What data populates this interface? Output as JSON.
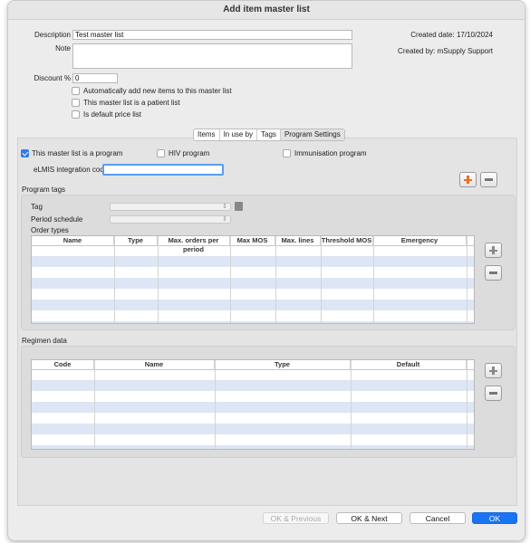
{
  "window": {
    "title": "Add item master list"
  },
  "header": {
    "description_label": "Description",
    "description_value": "Test master list",
    "note_label": "Note",
    "note_value": "",
    "discount_label": "Discount %",
    "discount_value": "0",
    "created_date": "Created date: 17/10/2024",
    "created_by": "Created by: mSupply Support",
    "checkboxes": [
      {
        "label": "Automatically add new items to this master list",
        "checked": false
      },
      {
        "label": "This master list is a patient list",
        "checked": false
      },
      {
        "label": "Is default price list",
        "checked": false
      }
    ]
  },
  "tabs": [
    {
      "label": "Items",
      "active": false
    },
    {
      "label": "In use by",
      "active": false
    },
    {
      "label": "Tags",
      "active": false
    },
    {
      "label": "Program Settings",
      "active": true
    }
  ],
  "program": {
    "is_program_label": "This master list is a program",
    "is_program_checked": true,
    "hiv_label": "HIV program",
    "hiv_checked": false,
    "immunisation_label": "Immunisation program",
    "immunisation_checked": false,
    "elmis_label": "eLMIS integration code",
    "elmis_value": ""
  },
  "program_tags": {
    "section_label": "Program tags",
    "tag_label": "Tag",
    "tag_value": "",
    "period_label": "Period schedule",
    "period_value": "",
    "order_types_label": "Order types",
    "columns": [
      "Name",
      "Type",
      "Max. orders per period",
      "Max MOS",
      "Max. lines",
      "Threshold MOS",
      "Emergency"
    ],
    "rows": []
  },
  "regimen": {
    "section_label": "Regimen data",
    "columns": [
      "Code",
      "Name",
      "Type",
      "Default"
    ],
    "rows": []
  },
  "footer": {
    "prev_label": "OK & Previous",
    "next_label": "OK & Next",
    "cancel_label": "Cancel",
    "ok_label": "OK"
  },
  "colors": {
    "accent": "#1a73f0",
    "add_orange": "#e8702a",
    "row_alt": "#dde6f5"
  }
}
